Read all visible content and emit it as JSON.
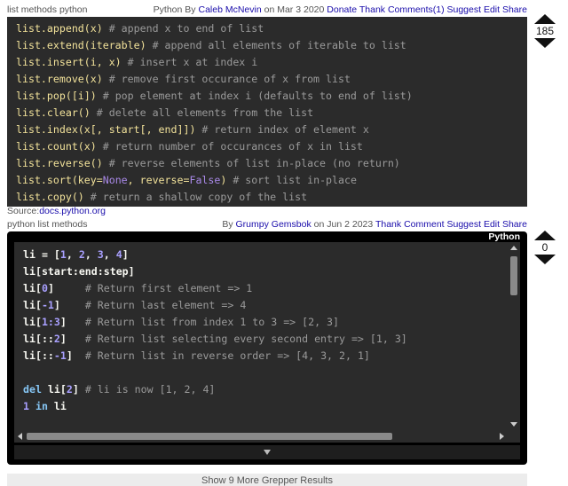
{
  "answer1": {
    "title": "list methods python",
    "language": "Python",
    "by_label": "By",
    "author": "Caleb McNevin",
    "on_label": "on",
    "date": "Mar 3 2020",
    "actions": [
      "Donate",
      "Thank",
      "Comments(1)",
      "Suggest Edit",
      "Share"
    ],
    "votes": "185",
    "code": [
      {
        "call": "list.append(x)",
        "comment": "# append x to end of list"
      },
      {
        "call": "list.extend(iterable)",
        "comment": "# append all elements of iterable to list"
      },
      {
        "call": "list.insert(i, x)",
        "comment": "# insert x at index i"
      },
      {
        "call": "list.remove(x)",
        "comment": "# remove first occurance of x from list"
      },
      {
        "call": "list.pop([i])",
        "comment": "# pop element at index i (defaults to end of list)"
      },
      {
        "call": "list.clear()",
        "comment": "# delete all elements from the list"
      },
      {
        "call": "list.index(x[, start[, end]])",
        "comment": "# return index of element x"
      },
      {
        "call": "list.count(x)",
        "comment": "# return number of occurances of x in list"
      },
      {
        "call": "list.reverse()",
        "comment": "# reverse elements of list in-place (no return)"
      },
      {
        "call_pre": "list.sort(key=",
        "kw1": "None",
        "call_mid": ", reverse=",
        "kw2": "False",
        "call_post": ")",
        "comment": "# sort list in-place"
      },
      {
        "call": "list.copy()",
        "comment": "# return a shallow copy of the list"
      }
    ],
    "source_label": "Source:",
    "source_link": "docs.python.org"
  },
  "answer2": {
    "title": "python list methods",
    "by_label": "By",
    "author": "Grumpy Gemsbok",
    "on_label": "on",
    "date": "Jun 2 2023",
    "actions": [
      "Thank",
      "Comment",
      "Suggest Edit",
      "Share"
    ],
    "language_tag": "Python",
    "votes": "0",
    "code": [
      {
        "text": "li = [",
        "nums": [
          "1",
          "2",
          "3",
          "4"
        ],
        "end": "]"
      },
      {
        "text": "li[start:end:step]"
      },
      {
        "pre": "li[",
        "num": "0",
        "post": "]     ",
        "comment": "# Return first element => 1"
      },
      {
        "pre": "li[",
        "num": "-1",
        "post": "]    ",
        "comment": "# Return last element => 4"
      },
      {
        "pre": "li[",
        "num": "1:3",
        "post": "]   ",
        "comment": "# Return list from index 1 to 3 => [2, 3]"
      },
      {
        "pre": "li[::",
        "num": "2",
        "post": "]   ",
        "comment": "# Return list selecting every second entry => [1, 3]"
      },
      {
        "pre": "li[::",
        "num": "-1",
        "post": "]  ",
        "comment": "# Return list in reverse order => [4, 3, 2, 1]"
      },
      {
        "blank": true
      },
      {
        "kw": "del",
        "pre": " li[",
        "num": "2",
        "post": "] ",
        "comment": "# li is now [1, 2, 4]"
      },
      {
        "num_first": "1",
        "kw": " in",
        "post": " li"
      }
    ]
  },
  "more_results": "Show 9 More Grepper Results"
}
